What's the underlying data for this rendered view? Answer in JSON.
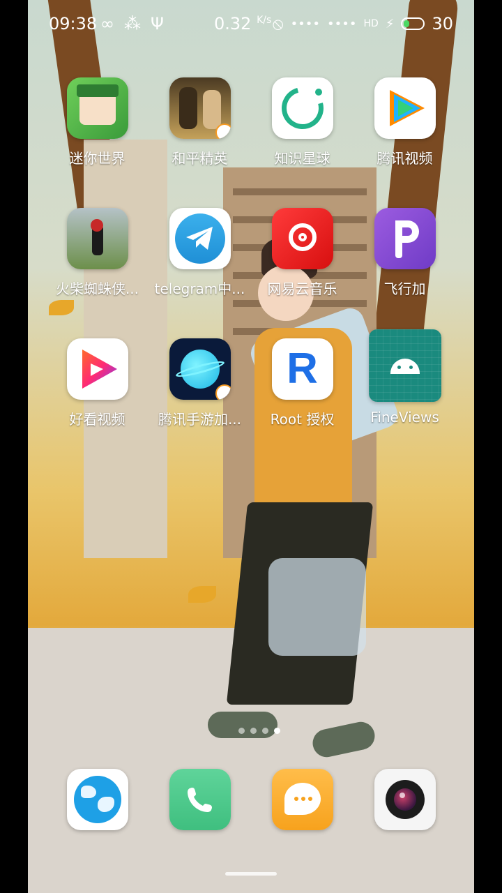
{
  "status_bar": {
    "time": "09:38",
    "net_speed": "0.32",
    "net_unit": "K/s",
    "battery": "30"
  },
  "apps": [
    {
      "label": "迷你世界",
      "icon": "mini-world-icon"
    },
    {
      "label": "和平精英",
      "icon": "peace-elite-icon"
    },
    {
      "label": "知识星球",
      "icon": "knowledge-planet-icon"
    },
    {
      "label": "腾讯视频",
      "icon": "tencent-video-icon"
    },
    {
      "label": "火柴蜘蛛侠...",
      "icon": "stickman-spider-icon"
    },
    {
      "label": "telegram中...",
      "icon": "telegram-icon"
    },
    {
      "label": "网易云音乐",
      "icon": "netease-music-icon"
    },
    {
      "label": "飞行加",
      "icon": "feixingjia-icon"
    },
    {
      "label": "好看视频",
      "icon": "haokan-video-icon"
    },
    {
      "label": "腾讯手游加...",
      "icon": "tencent-game-booster-icon"
    },
    {
      "label": "Root 授权",
      "icon": "root-auth-icon"
    },
    {
      "label": "FineViews",
      "icon": "android-icon"
    }
  ],
  "dock": [
    {
      "icon": "browser-globe-icon"
    },
    {
      "icon": "phone-icon"
    },
    {
      "icon": "messages-icon"
    },
    {
      "icon": "camera-icon"
    }
  ],
  "page_indicator": {
    "pages": 4,
    "active_page": 4
  }
}
